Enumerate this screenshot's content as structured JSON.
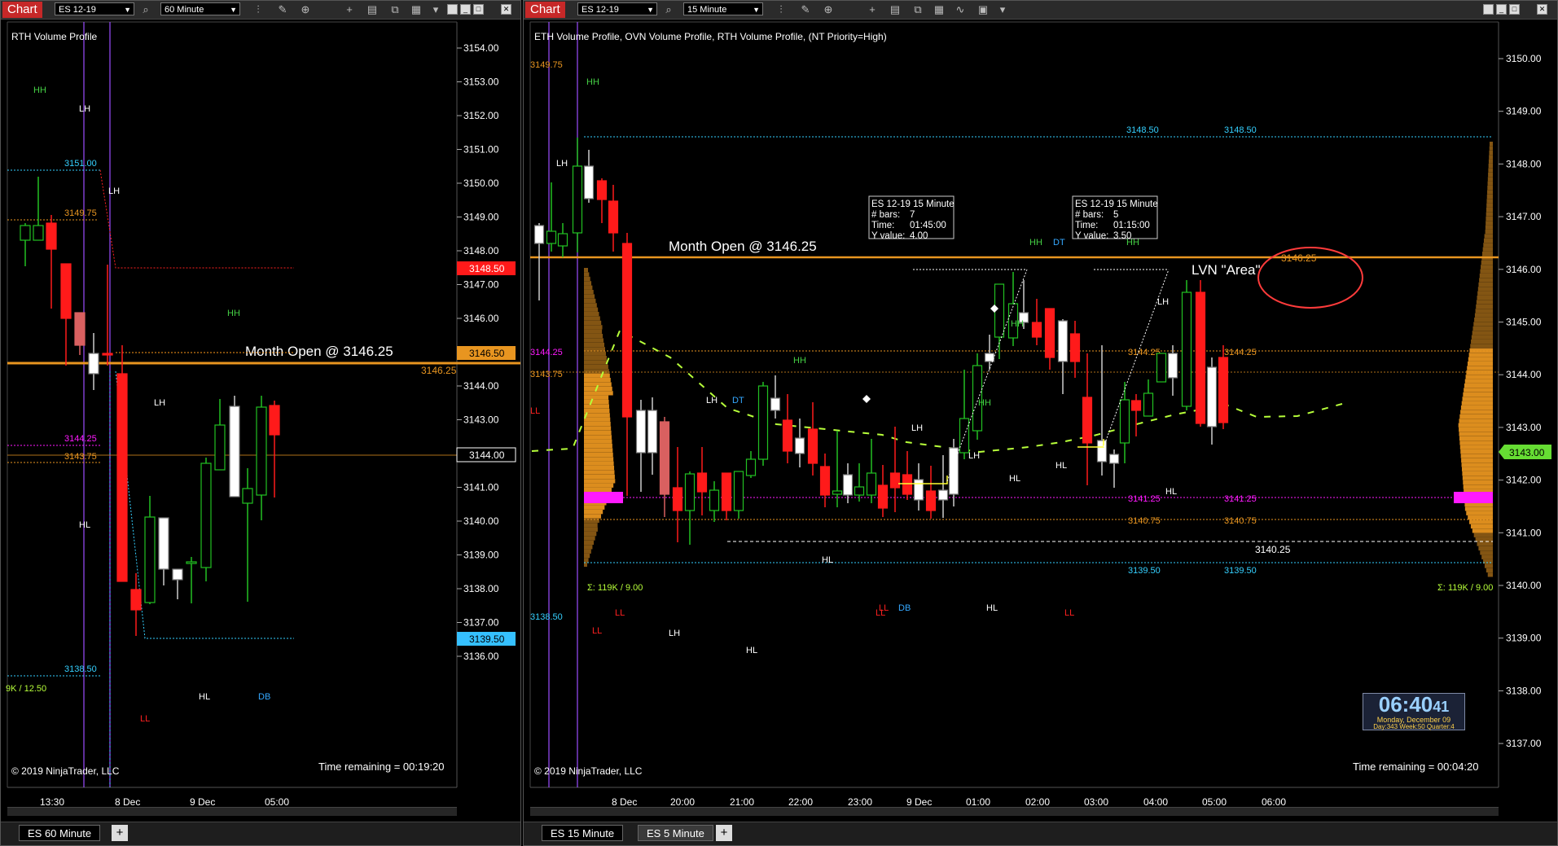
{
  "colors": {
    "background": "#000000",
    "bull": "#22c022",
    "bear": "#ff1a1a",
    "bear_light": "#d96060",
    "month_open": "#e89520",
    "purple_line": "#9b4dff",
    "cyan": "#35d0ff",
    "magenta": "#ff1aff",
    "orange_lvl": "#e89520",
    "profile": "#e89520",
    "swing_hh": "#45d045",
    "swing_hl": "#ffffff",
    "swing_ll": "#ff2020",
    "swing_db": "#35a8ff",
    "yellow": "#ffff33",
    "vwap": "#b7ff3a"
  },
  "left": {
    "chart_button": "Chart",
    "instrument": "ES 12-19",
    "interval": "60 Minute",
    "indicator_label": "RTH Volume Profile",
    "copyright": "© 2019 NinjaTrader, LLC",
    "time_remaining": "Time remaining = 00:19:20",
    "month_open_label": "Month Open @ 3146.25",
    "price_axis": [
      "3154.00",
      "3153.00",
      "3152.00",
      "3151.00",
      "3150.00",
      "3149.00",
      "3148.00",
      "3147.00",
      "3146.00",
      "3145.00",
      "3144.00",
      "3143.00",
      "3142.00",
      "3141.00",
      "3140.00",
      "3139.00",
      "3138.00",
      "3137.00",
      "3136.00"
    ],
    "time_axis": [
      "13:30",
      "8 Dec",
      "9 Dec",
      "05:00"
    ],
    "tags": {
      "t1": "3148.50",
      "t2": "3146.50",
      "t3": "3144.00",
      "t4": "3139.50"
    },
    "levels": {
      "l1": "3151.00",
      "l2": "3149.75",
      "l3": "3146.25",
      "l4": "3144.25",
      "l5": "3143.75",
      "l6": "3138.50",
      "l7": "9K / 12.50"
    },
    "swings": {
      "s1": "HH",
      "s2": "LH",
      "s3": "LH",
      "s4": "HH",
      "s5": "LH",
      "s6": "HL",
      "s7": "HL",
      "s8": "DB",
      "s9": "LL"
    },
    "tab": "ES  60 Minute",
    "tab_add": "+"
  },
  "right": {
    "chart_button": "Chart",
    "instrument": "ES 12-19",
    "interval": "15 Minute",
    "indicator_label": "ETH Volume Profile, OVN Volume Profile, RTH Volume Profile, (NT Priority=High)",
    "copyright": "© 2019 NinjaTrader, LLC",
    "time_remaining": "Time remaining = 00:04:20",
    "month_open_label": "Month Open @ 3146.25",
    "lvn_label": "LVN \"Area\"",
    "price_axis": [
      "3150.00",
      "3149.00",
      "3148.00",
      "3147.00",
      "3146.00",
      "3145.00",
      "3144.00",
      "3143.00",
      "3142.00",
      "3141.00",
      "3140.00",
      "3139.00",
      "3138.00",
      "3137.00"
    ],
    "time_axis": [
      "8 Dec",
      "20:00",
      "21:00",
      "22:00",
      "23:00",
      "9 Dec",
      "01:00",
      "02:00",
      "03:00",
      "04:00",
      "05:00",
      "06:00"
    ],
    "tag": "3143.00",
    "levels": {
      "a": "3149.75",
      "b": "3148.50",
      "c": "3148.50",
      "d": "3146.25",
      "e": "3144.25",
      "f": "3143.75",
      "g": "3144.25",
      "h": "3144.25",
      "i": "3141.25",
      "j": "3141.25",
      "k": "3140.75",
      "l": "3140.75",
      "m": "3140.25",
      "n": "3139.50",
      "o": "3139.50",
      "p": "3138.50",
      "q": "Σ: 119K / 9.00",
      "r": "Σ: 119K / 9.00"
    },
    "swings": {
      "s1": "HH",
      "s2": "LH",
      "s3": "LH",
      "s4": "DT",
      "s5": "HH",
      "s6": "LH",
      "s7": "LH",
      "s8": "HH",
      "s9": "HH",
      "s10": "DT",
      "s11": "HH",
      "s12": "LH",
      "s13": "HL",
      "s14": "HL",
      "s15": "HL",
      "s16": "HL",
      "s17": "HL",
      "s18": "HH",
      "s19": "LL",
      "s20": "LL",
      "s21": "DB",
      "s22": "LL",
      "s23": "LL",
      "s24": "LL",
      "s25": "HL"
    },
    "tooltip1": {
      "title": "ES 12-19 15 Minute",
      "bars_label": "# bars:",
      "bars": "7",
      "time_label": "Time:",
      "time": "01:45:00",
      "y_label": "Y value:",
      "y": "4.00"
    },
    "tooltip2": {
      "title": "ES 12-19 15 Minute",
      "bars_label": "# bars:",
      "bars": "5",
      "time_label": "Time:",
      "time": "01:15:00",
      "y_label": "Y value:",
      "y": "3.50"
    },
    "clock": {
      "time": "06:40",
      "seconds": "41",
      "date": "Monday, December 09",
      "stats": "Day:343  Week:50  Quarter:4"
    },
    "tabs": [
      "ES  15 Minute",
      "ES  5 Minute"
    ],
    "tab_add": "+"
  }
}
